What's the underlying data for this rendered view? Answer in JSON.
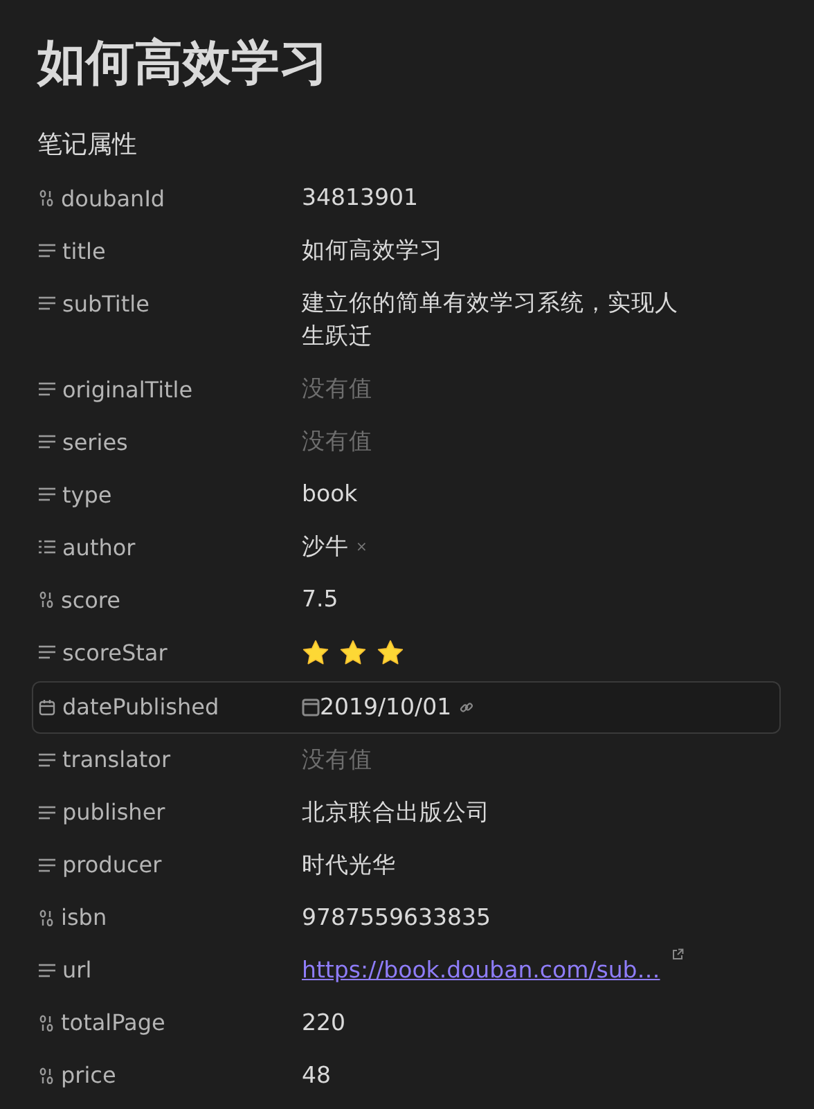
{
  "title": "如何高效学习",
  "section": "笔记属性",
  "properties": [
    {
      "key": "doubanId",
      "kind": "number",
      "selected": false,
      "value": {
        "kind": "text",
        "text": "34813901"
      }
    },
    {
      "key": "title",
      "kind": "text",
      "selected": false,
      "value": {
        "kind": "text",
        "text": "如何高效学习"
      }
    },
    {
      "key": "subTitle",
      "kind": "text",
      "selected": false,
      "value": {
        "kind": "text",
        "text": "建立你的简单有效学习系统，实现人生跃迁"
      }
    },
    {
      "key": "originalTitle",
      "kind": "text",
      "selected": false,
      "value": {
        "kind": "empty",
        "text": "没有值"
      }
    },
    {
      "key": "series",
      "kind": "text",
      "selected": false,
      "value": {
        "kind": "empty",
        "text": "没有值"
      }
    },
    {
      "key": "type",
      "kind": "text",
      "selected": false,
      "value": {
        "kind": "text",
        "text": "book"
      }
    },
    {
      "key": "author",
      "kind": "list",
      "selected": false,
      "value": {
        "kind": "tags",
        "tags": [
          "沙牛"
        ],
        "remove": "×"
      }
    },
    {
      "key": "score",
      "kind": "number",
      "selected": false,
      "value": {
        "kind": "text",
        "text": "7.5"
      }
    },
    {
      "key": "scoreStar",
      "kind": "text",
      "selected": false,
      "value": {
        "kind": "stars",
        "stars": 3
      }
    },
    {
      "key": "datePublished",
      "kind": "date",
      "selected": true,
      "value": {
        "kind": "date",
        "text": "2019/10/01"
      }
    },
    {
      "key": "translator",
      "kind": "text",
      "selected": false,
      "value": {
        "kind": "empty",
        "text": "没有值"
      }
    },
    {
      "key": "publisher",
      "kind": "text",
      "selected": false,
      "value": {
        "kind": "text",
        "text": "北京联合出版公司"
      }
    },
    {
      "key": "producer",
      "kind": "text",
      "selected": false,
      "value": {
        "kind": "text",
        "text": "时代光华"
      }
    },
    {
      "key": "isbn",
      "kind": "number",
      "selected": false,
      "value": {
        "kind": "text",
        "text": "9787559633835"
      }
    },
    {
      "key": "url",
      "kind": "text",
      "selected": false,
      "value": {
        "kind": "link",
        "text": "https://book.douban.com/sub…"
      }
    },
    {
      "key": "totalPage",
      "kind": "number",
      "selected": false,
      "value": {
        "kind": "text",
        "text": "220"
      }
    },
    {
      "key": "price",
      "kind": "number",
      "selected": false,
      "value": {
        "kind": "text",
        "text": "48"
      }
    }
  ]
}
